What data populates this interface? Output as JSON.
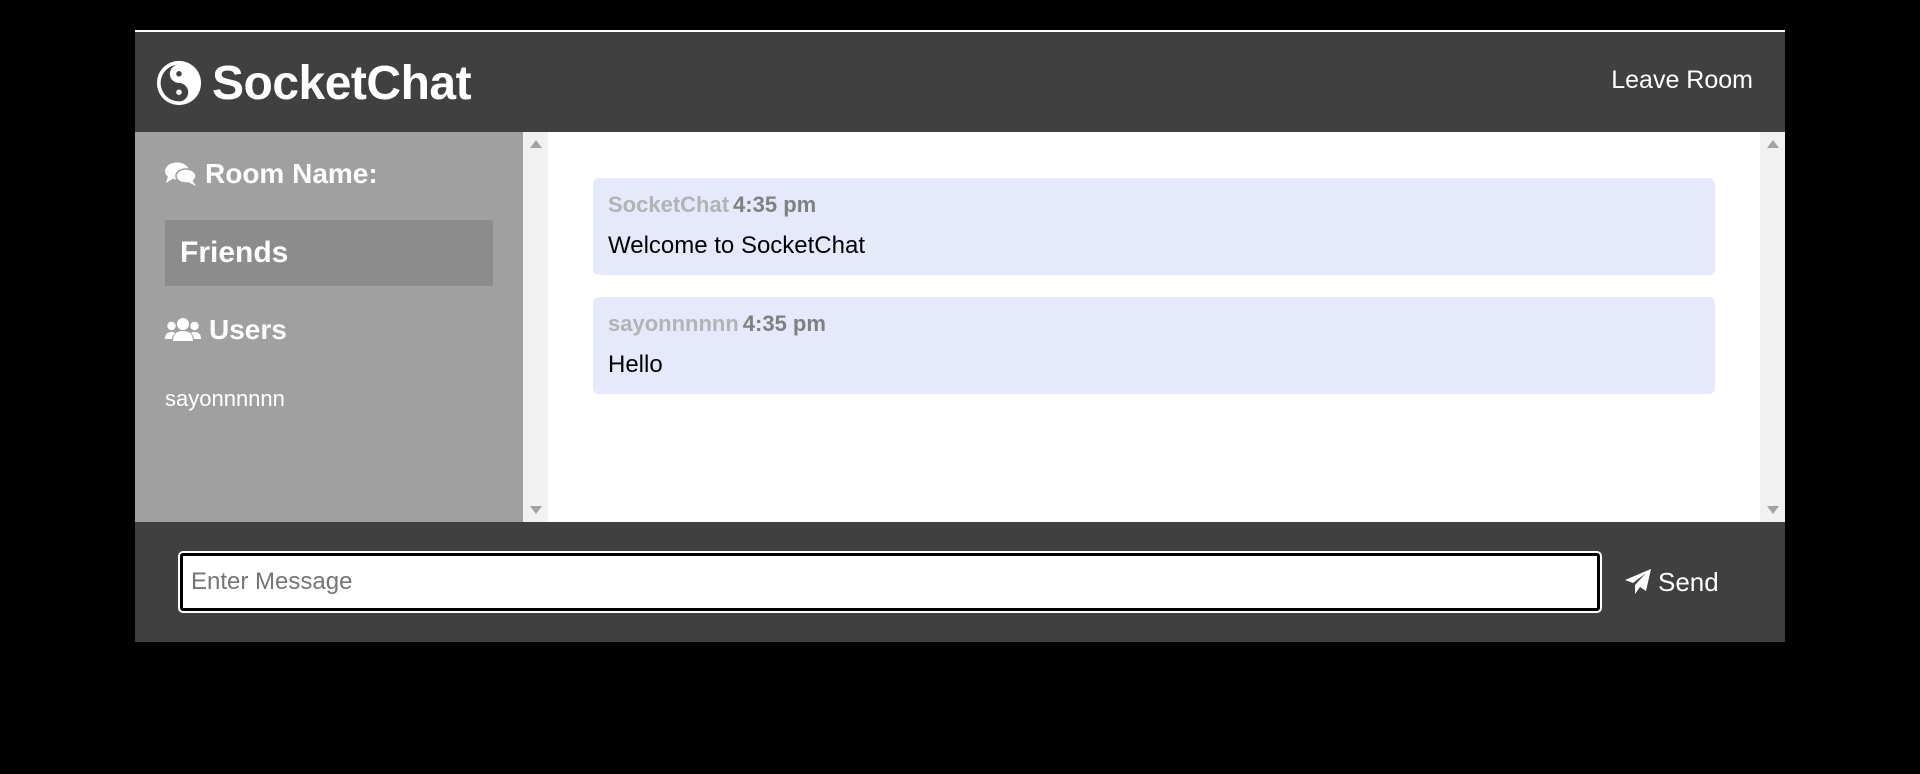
{
  "header": {
    "brand_icon": "yin-yang-icon",
    "title": "SocketChat",
    "leave_label": "Leave Room"
  },
  "sidebar": {
    "room_icon": "comments-icon",
    "room_heading": "Room Name:",
    "room_name": "Friends",
    "users_icon": "users-icon",
    "users_heading": "Users",
    "users": [
      "sayonnnnnn"
    ]
  },
  "messages": [
    {
      "username": "SocketChat",
      "time": "4:35 pm",
      "text": "Welcome to SocketChat"
    },
    {
      "username": "sayonnnnnn",
      "time": "4:35 pm",
      "text": "Hello"
    }
  ],
  "composer": {
    "placeholder": "Enter Message",
    "value": "",
    "send_icon": "paper-plane-icon",
    "send_label": "Send"
  },
  "colors": {
    "header_bg": "#404040",
    "sidebar_bg": "#a0a0a0",
    "room_box_bg": "#8c8c8c",
    "message_bg": "#e6e8fc",
    "page_bg": "#000000"
  }
}
